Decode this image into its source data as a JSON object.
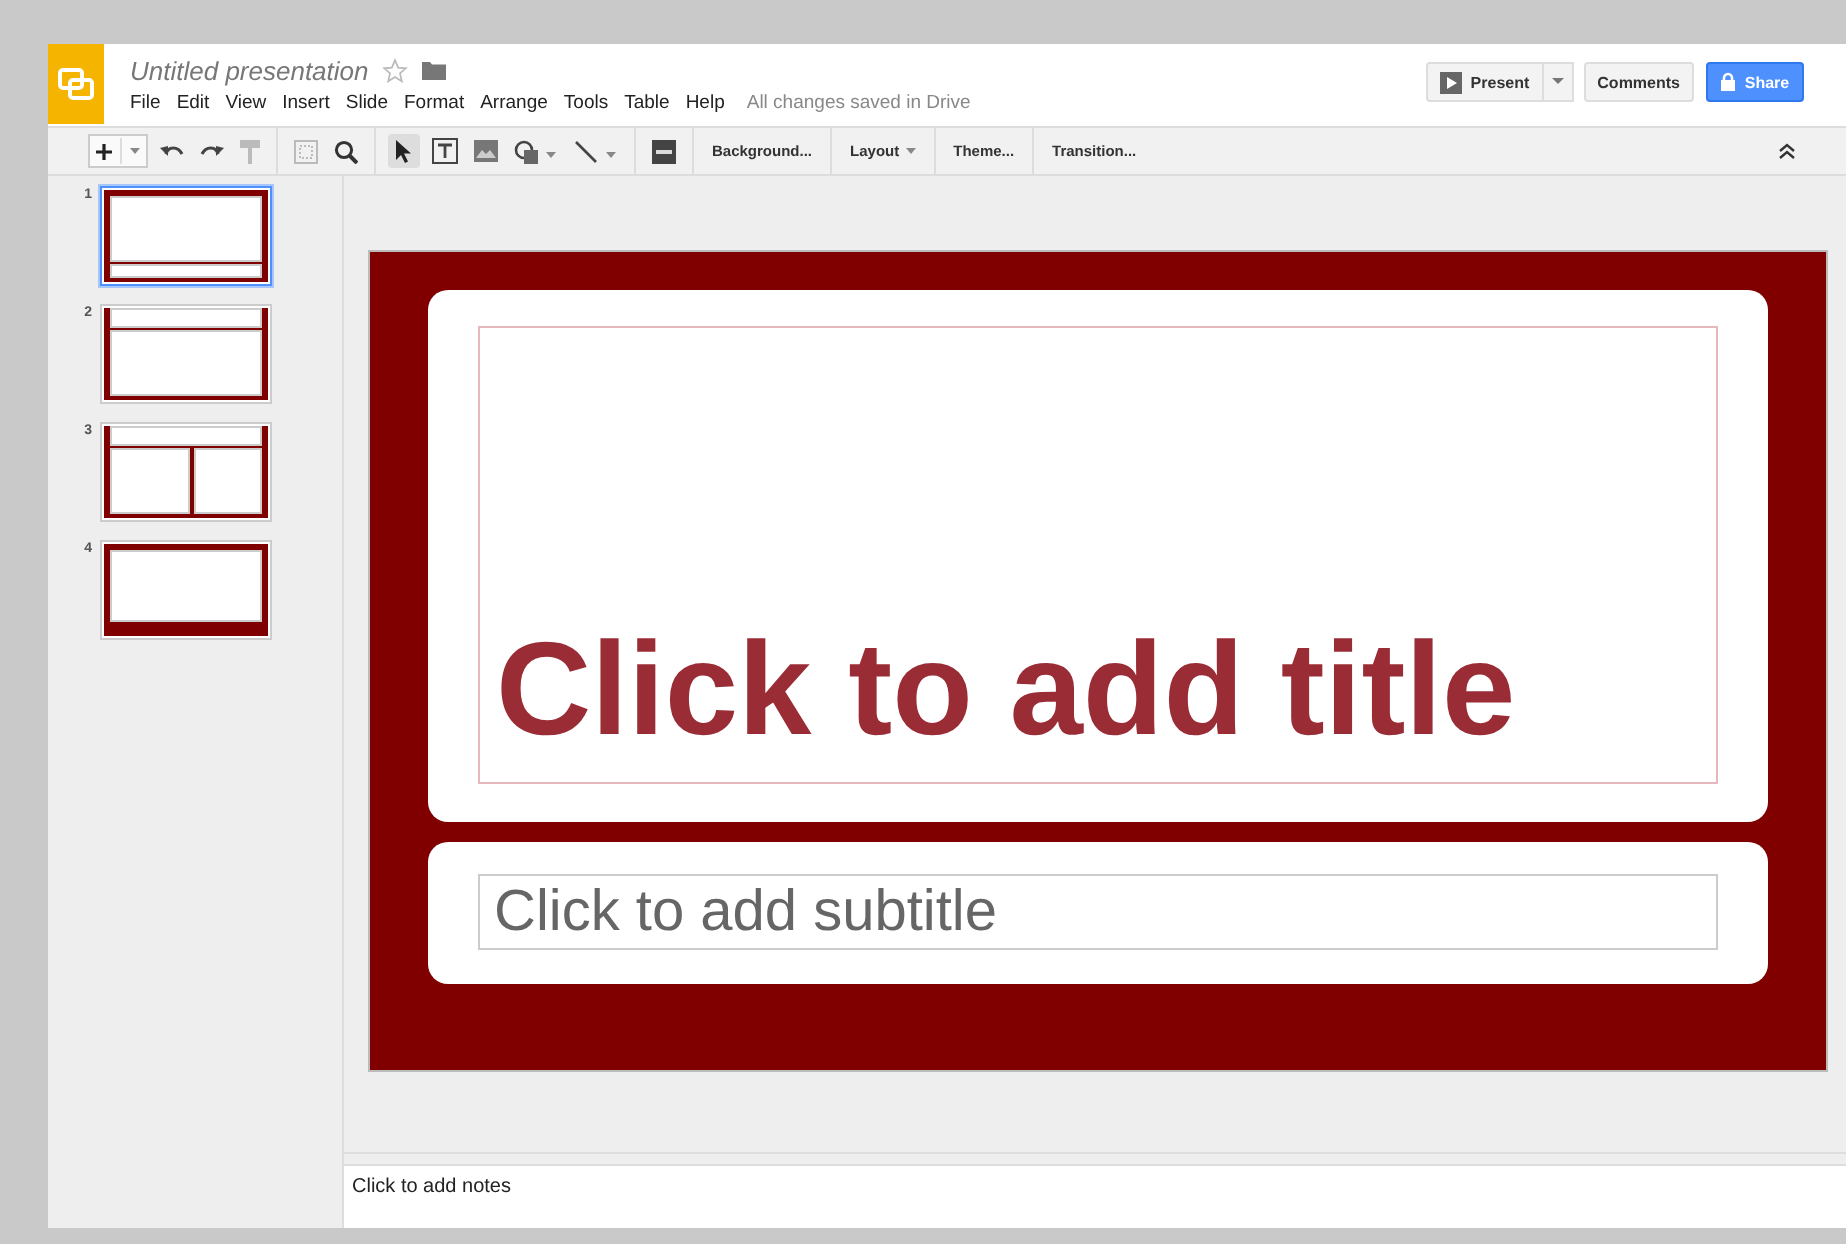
{
  "doc": {
    "title": "Untitled presentation",
    "starred": false,
    "status": "All changes saved in Drive"
  },
  "menu": [
    "File",
    "Edit",
    "View",
    "Insert",
    "Slide",
    "Format",
    "Arrange",
    "Tools",
    "Table",
    "Help"
  ],
  "actions": {
    "present": "Present",
    "comments": "Comments",
    "share": "Share"
  },
  "toolbar_menus": [
    {
      "label": "Background...",
      "dropdown": false
    },
    {
      "label": "Layout",
      "dropdown": true
    },
    {
      "label": "Theme...",
      "dropdown": false
    },
    {
      "label": "Transition...",
      "dropdown": false
    }
  ],
  "slides": [
    {
      "number": "1",
      "selected": true,
      "kind": "title"
    },
    {
      "number": "2",
      "selected": false,
      "kind": "header"
    },
    {
      "number": "3",
      "selected": false,
      "kind": "two-column"
    },
    {
      "number": "4",
      "selected": false,
      "kind": "caption"
    }
  ],
  "slide": {
    "title_placeholder": "Click to add title",
    "subtitle_placeholder": "Click to add subtitle"
  },
  "notes": {
    "placeholder": "Click to add notes"
  }
}
